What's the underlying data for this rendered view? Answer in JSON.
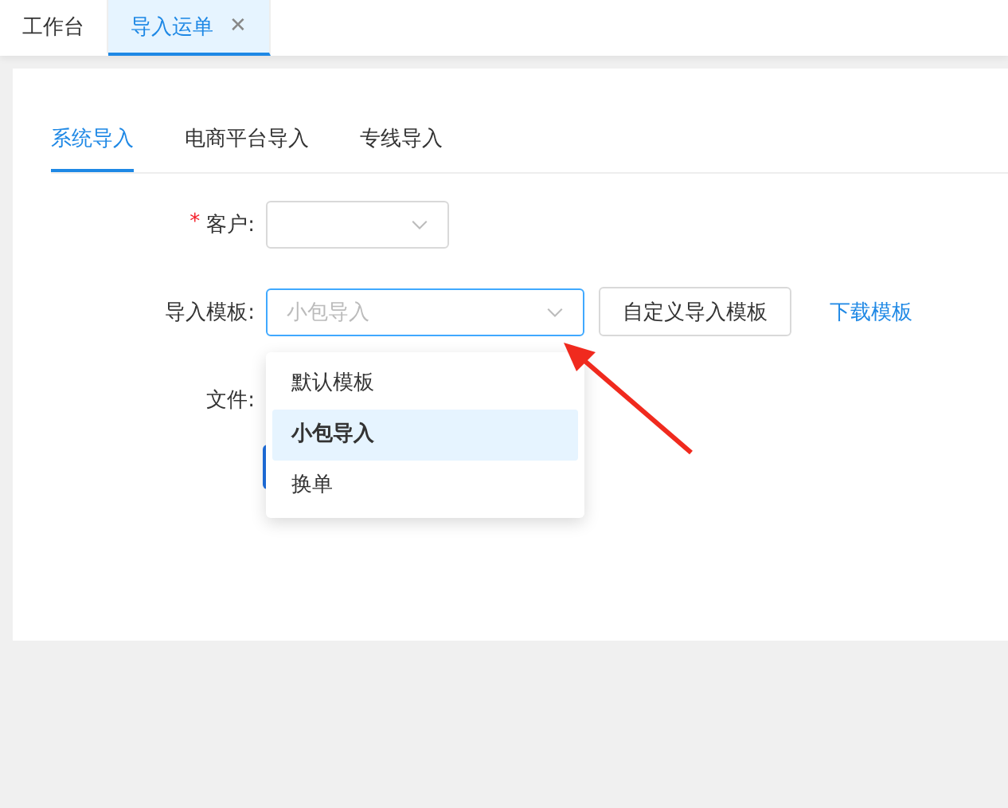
{
  "page_tabs": [
    {
      "label": "工作台",
      "selected": false,
      "closable": false
    },
    {
      "label": "导入运单",
      "selected": true,
      "closable": true,
      "close_glyph": "✕"
    }
  ],
  "import_tabs": [
    {
      "label": "系统导入",
      "selected": true
    },
    {
      "label": "电商平台导入",
      "selected": false
    },
    {
      "label": "专线导入",
      "selected": false
    }
  ],
  "form": {
    "customer": {
      "label": "客户:",
      "required": true,
      "required_mark": "*"
    },
    "template": {
      "label": "导入模板:",
      "placeholder": "小包导入",
      "focused": true,
      "custom_button": "自定义导入模板",
      "download_link": "下载模板"
    },
    "file": {
      "label": "文件:"
    }
  },
  "dropdown": {
    "options": [
      {
        "label": "默认模板",
        "selected": false
      },
      {
        "label": "小包导入",
        "selected": true
      },
      {
        "label": "换单",
        "selected": false
      }
    ]
  }
}
